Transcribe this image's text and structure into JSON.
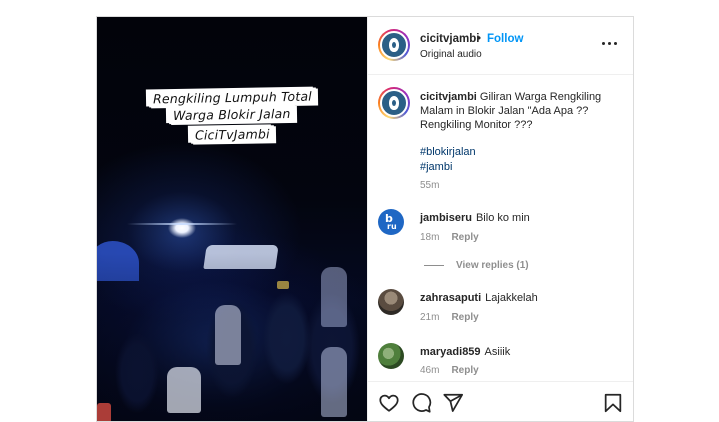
{
  "media": {
    "overlay_lines": [
      "Rengkiling Lumpuh Total",
      "Warga Blokir Jalan",
      "CiciTvJambi"
    ]
  },
  "header": {
    "username": "cicitvjambi",
    "separator": "•",
    "follow_label": "Follow",
    "subtitle": "Original audio"
  },
  "caption": {
    "username": "cicitvjambi",
    "text": "Giliran Warga Rengkiling Malam in Blokir Jalan \"Ada Apa ?? Rengkiling Monitor ???",
    "hashtags": [
      "#blokirjalan",
      "#jambi"
    ],
    "time": "55m"
  },
  "comments": [
    {
      "username": "jambiseru",
      "text": "Bilo ko min",
      "time": "18m",
      "reply_label": "Reply"
    },
    {
      "username": "zahrasaputi",
      "text": "Lajakkelah",
      "time": "21m",
      "reply_label": "Reply"
    },
    {
      "username": "maryadi859",
      "text": "Asiiik",
      "time": "46m",
      "reply_label": "Reply"
    }
  ],
  "view_replies_label": "View replies (1)",
  "icons": {
    "like": "heart-icon",
    "comment": "comment-icon",
    "share": "share-icon",
    "save": "bookmark-icon",
    "more": "more-options-icon"
  },
  "colors": {
    "follow": "#0095f6",
    "hashtag": "#00376b",
    "muted": "#8e8e8e",
    "text": "#262626"
  }
}
